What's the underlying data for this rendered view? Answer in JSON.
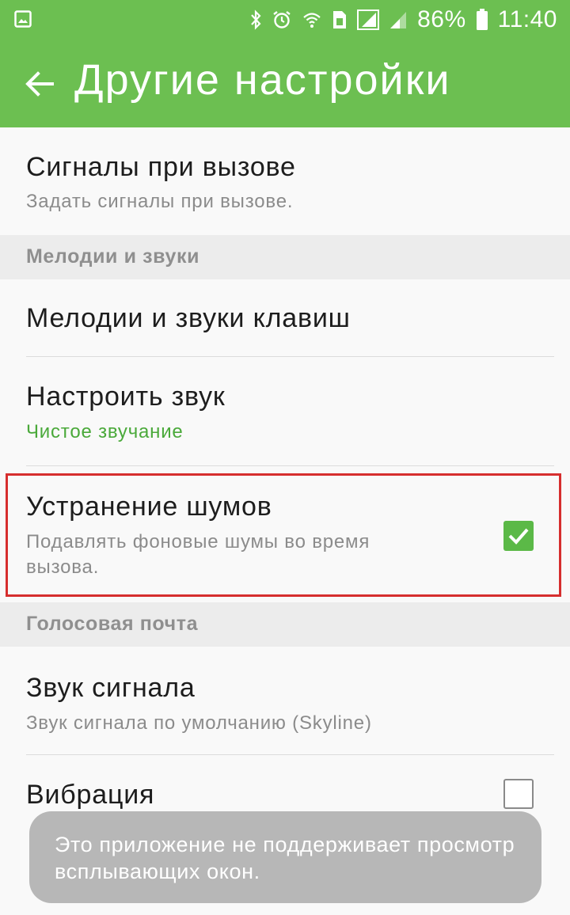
{
  "status_bar": {
    "battery": "86%",
    "time": "11:40",
    "icons": [
      "gallery-notification-icon",
      "bluetooth-icon",
      "alarm-icon",
      "wifi-calling-icon",
      "sim-icon",
      "signal-icon",
      "signal-icon-2",
      "battery-icon"
    ]
  },
  "app_bar": {
    "title": "Другие настройки",
    "back_icon": "arrow-back-icon",
    "color": "#6cbf51"
  },
  "items": {
    "call_alerts": {
      "title": "Сигналы при вызове",
      "subtitle": "Задать сигналы при вызове."
    },
    "section_sounds": "Мелодии и звуки",
    "keypad_sounds": {
      "title": "Мелодии и звуки клавиш"
    },
    "adjust_sound": {
      "title": "Настроить звук",
      "subtitle": "Чистое звучание"
    },
    "noise_reduction": {
      "title": "Устранение шумов",
      "subtitle": "Подавлять фоновые шумы во время вызова.",
      "checked": true
    },
    "section_voicemail": "Голосовая почта",
    "alert_sound": {
      "title": "Звук сигнала",
      "subtitle": "Звук сигнала по умолчанию (Skyline)"
    },
    "vibration": {
      "title": "Вибрация",
      "checked": false
    }
  },
  "toast": {
    "message": "Это приложение не поддерживает просмотр всплывающих окон."
  },
  "colors": {
    "accent": "#6cbf51",
    "checkbox_on": "#5bb947",
    "highlight": "#d62e2e",
    "subtitle_green": "#4aa93a"
  }
}
